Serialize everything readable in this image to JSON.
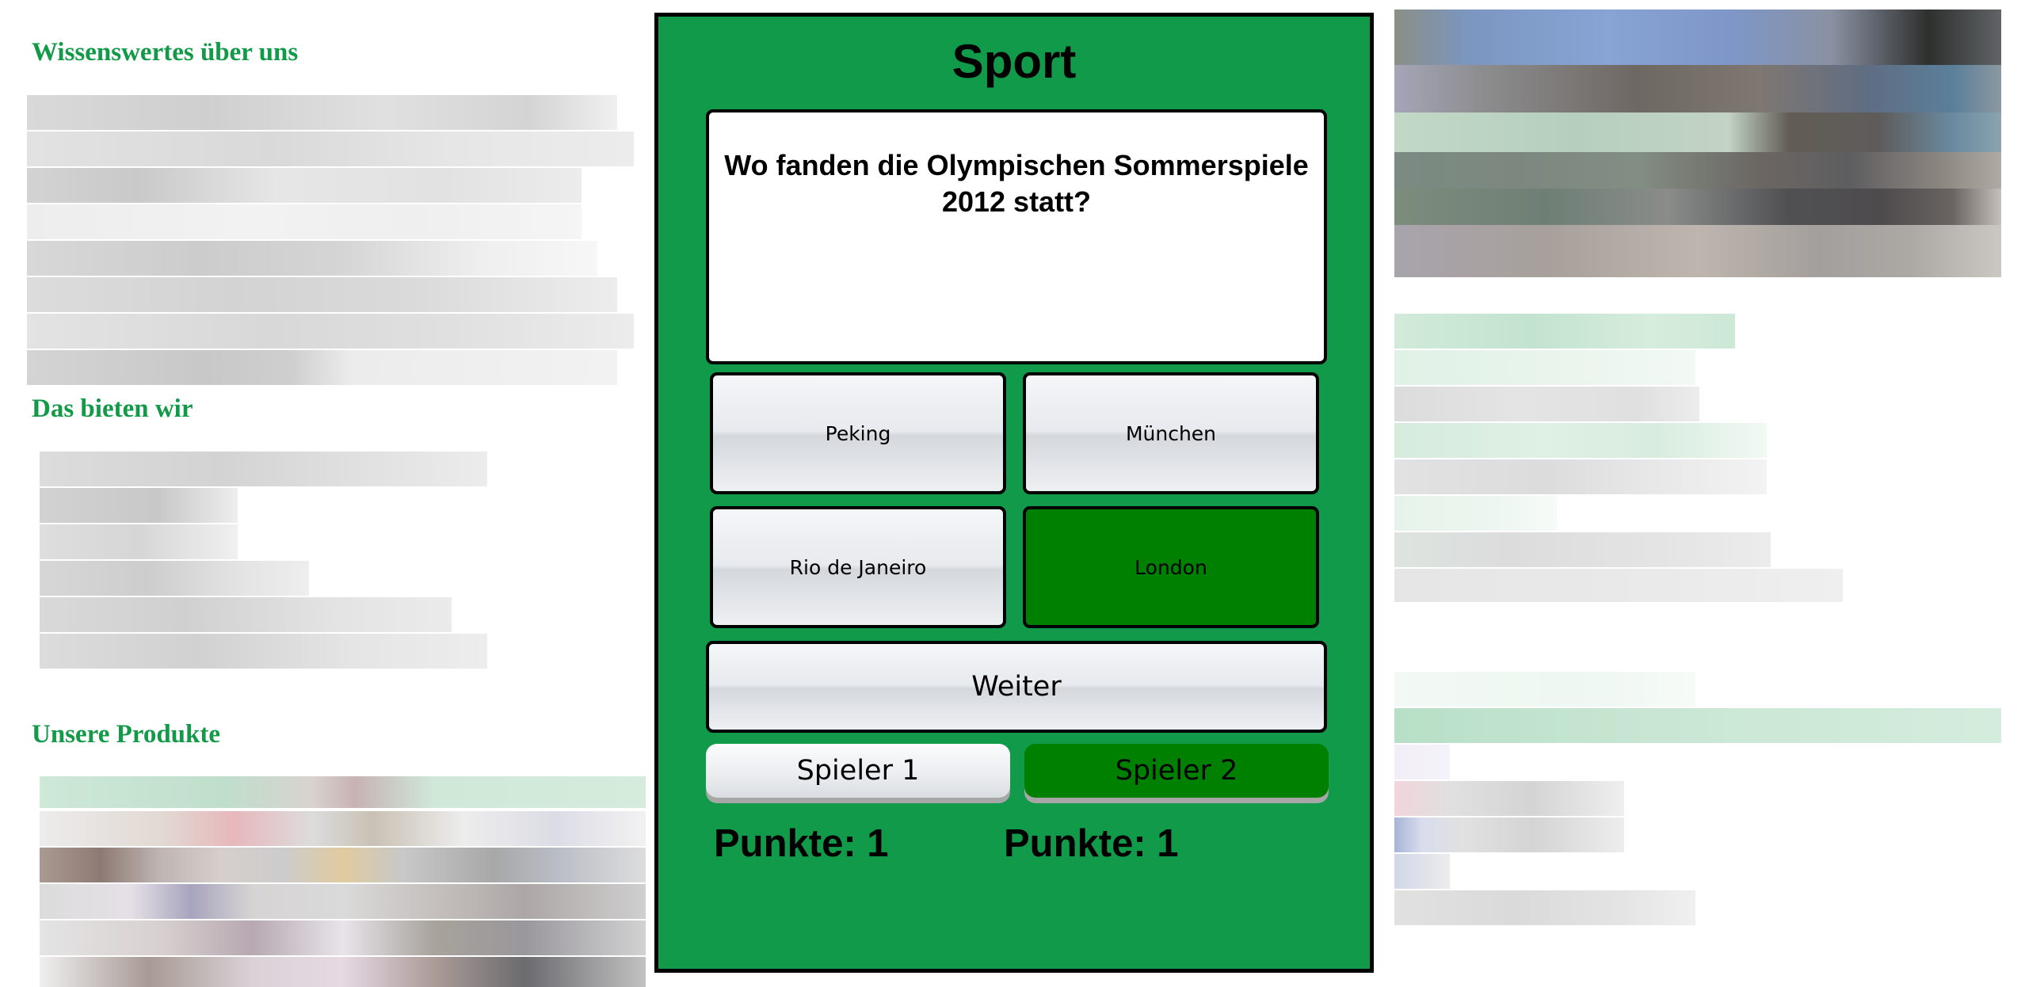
{
  "left_column": {
    "headings": [
      "Wissenswertes über uns",
      "Das bieten wir",
      "Unsere Produkte"
    ]
  },
  "quiz": {
    "category": "Sport",
    "question": "Wo fanden die Olympischen Sommerspiele 2012 statt?",
    "answers": [
      {
        "label": "Peking",
        "state": "default"
      },
      {
        "label": "München",
        "state": "default"
      },
      {
        "label": "Rio de Janeiro",
        "state": "default"
      },
      {
        "label": "London",
        "state": "correct"
      }
    ],
    "next_label": "Weiter",
    "players": [
      {
        "label": "Spieler 1",
        "active": false
      },
      {
        "label": "Spieler 2",
        "active": true
      }
    ],
    "scores": [
      {
        "text": "Punkte: 1"
      },
      {
        "text": "Punkte: 1"
      }
    ]
  },
  "colors": {
    "brand_green": "#129a49",
    "panel_green": "#119a4a",
    "correct_green": "#008000",
    "button_gray": "#e7eaee"
  }
}
